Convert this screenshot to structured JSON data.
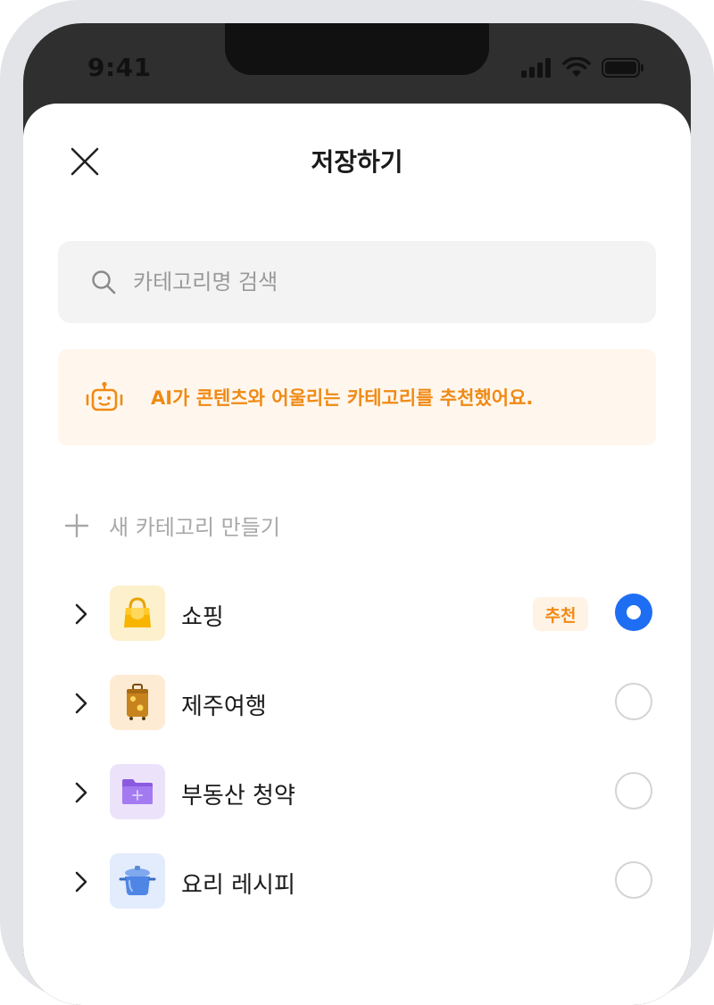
{
  "status_bar": {
    "time": "9:41"
  },
  "header": {
    "title": "저장하기"
  },
  "search": {
    "placeholder": "카테고리명 검색"
  },
  "ai_banner": {
    "text": "AI가 콘텐츠와 어울리는 카테고리를 추천했어요."
  },
  "new_category": {
    "label": "새 카테고리 만들기"
  },
  "categories": [
    {
      "label": "쇼핑",
      "badge": "추천",
      "selected": true,
      "icon": "shopping-bag-icon"
    },
    {
      "label": "제주여행",
      "selected": false,
      "icon": "suitcase-icon"
    },
    {
      "label": "부동산 청약",
      "selected": false,
      "icon": "folder-icon"
    },
    {
      "label": "요리 레시피",
      "selected": false,
      "icon": "cooking-pot-icon"
    }
  ],
  "colors": {
    "accent": "#1e6ef4",
    "ai_orange": "#f08a14",
    "ai_bg": "#fff7ee"
  }
}
